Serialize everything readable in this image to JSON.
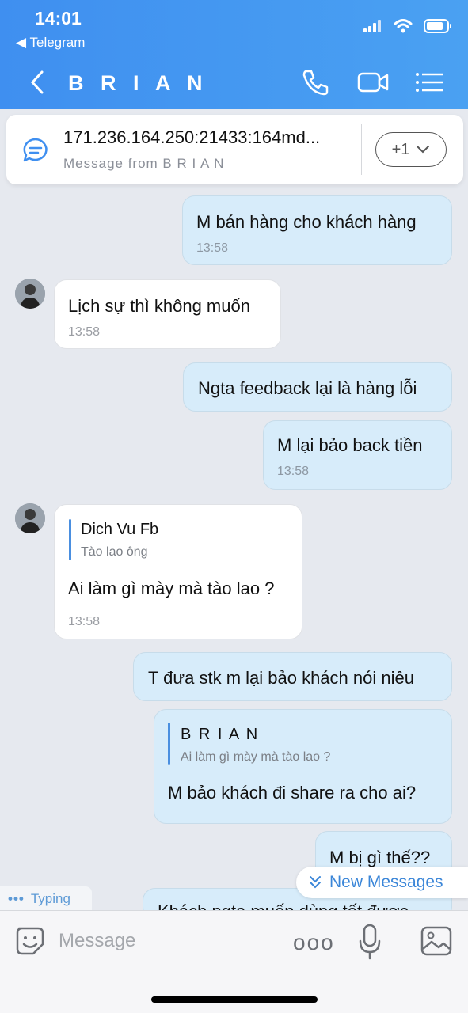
{
  "status_bar": {
    "time": "14:01",
    "back_app": "Telegram"
  },
  "chat": {
    "title": "B R I A N"
  },
  "pinned": {
    "text": "171.236.164.250:21433:164md...",
    "subtitle": "Message from B R I A N",
    "more": "+1"
  },
  "messages": [
    {
      "side": "out",
      "text": "M bán hàng cho khách hàng",
      "time": "13:58"
    },
    {
      "side": "in",
      "text": "Lịch sự thì không muốn",
      "time": "13:58"
    },
    {
      "side": "out",
      "text": "Ngta feedback lại là hàng lỗi",
      "time": ""
    },
    {
      "side": "out",
      "text": "M lại bảo back tiền",
      "time": "13:58"
    },
    {
      "side": "in",
      "reply_name": "Dich Vu Fb",
      "reply_text": "Tào lao ông",
      "text": "Ai làm gì mày mà tào lao ?",
      "time": "13:58"
    },
    {
      "side": "out",
      "text": "T đưa stk m lại bảo khách nói niêu",
      "time": ""
    },
    {
      "side": "out",
      "reply_name": "B R I A N",
      "reply_text": "Ai làm gì mày mà tào lao ?",
      "text": "M bảo khách đi share ra cho ai?",
      "time": ""
    },
    {
      "side": "out",
      "text": "M bị gì thế??",
      "time": ""
    },
    {
      "side": "out",
      "text": "Khách ngta muốn dùng tốt được",
      "time": ""
    }
  ],
  "typing": {
    "dots": "•••",
    "label": "Typing"
  },
  "new_messages": {
    "label": "New Messages"
  },
  "composer": {
    "placeholder": "Message",
    "more": "ooo"
  },
  "colors": {
    "header": "#4097f1",
    "out_bubble": "#d7ecfa",
    "in_bubble": "#ffffff",
    "accent": "#3b86d8"
  }
}
